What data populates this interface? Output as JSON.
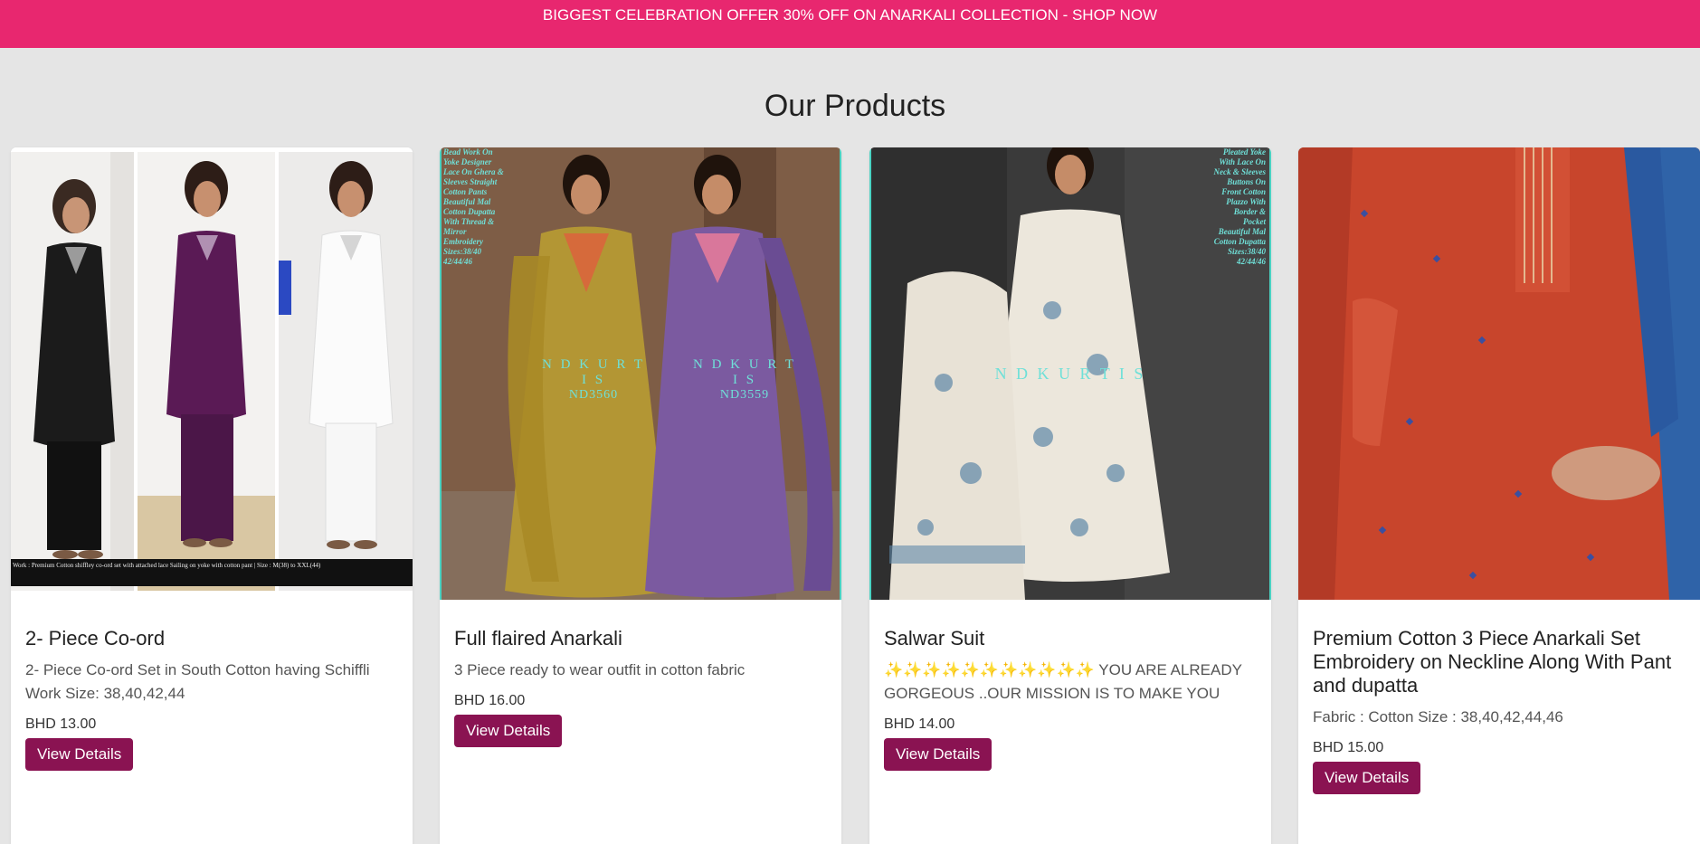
{
  "banner": {
    "text": "BIGGEST CELEBRATION OFFER 30% OFF ON ANARKALI COLLECTION - SHOP NOW"
  },
  "page": {
    "heading": "Our Products"
  },
  "products": [
    {
      "title": "2- Piece Co-ord",
      "description": "2- Piece Co-ord Set in South Cotton having Schiffli Work Size: 38,40,42,44",
      "price": "BHD 13.00",
      "button": "View Details",
      "image_caption": "Work : Premium Cotton shiffley co-ord set with attached lace Sailing on yoke with cotton pant | Size : M(38) to XXL(44)"
    },
    {
      "title": "Full flaired Anarkali",
      "description": "3 Piece ready to wear outfit in cotton fabric",
      "price": "BHD 16.00",
      "button": "View Details",
      "watermark_left": "N D K U R T I S",
      "code_left": "ND3560",
      "watermark_right": "N D K U R T I S",
      "code_right": "ND3559",
      "side_text": "Bead Work On Yoke Designer Lace On Ghera & Sleeves Straight Cotton Pants Beautiful Mal Cotton Dupatta With Thread & Mirror Embroidery Sizes:38/40 42/44/46"
    },
    {
      "title": "Salwar Suit",
      "description": "✨✨✨✨✨✨✨✨✨✨✨ YOU ARE ALREADY GORGEOUS ..OUR MISSION IS TO MAKE YOU FEEL THA...",
      "price": "BHD 14.00",
      "button": "View Details",
      "watermark": "N D K U R T I S",
      "side_text": "Pleated Yoke With Lace On Neck & Sleeves Buttons On Front Cotton Plazzo With Border & Pocket Beautiful Mal Cotton Dupatta Sizes:38/40 42/44/46"
    },
    {
      "title": "Premium Cotton 3 Piece Anarkali Set Embroidery on Neckline Along With Pant and dupatta",
      "description": "Fabric : Cotton Size : 38,40,42,44,46",
      "price": "BHD 15.00",
      "button": "View Details"
    }
  ],
  "colors": {
    "banner_bg": "#e8276f",
    "page_bg": "#e5e5e5",
    "button_bg": "#8a1352",
    "watermark": "#6fe0d8"
  }
}
